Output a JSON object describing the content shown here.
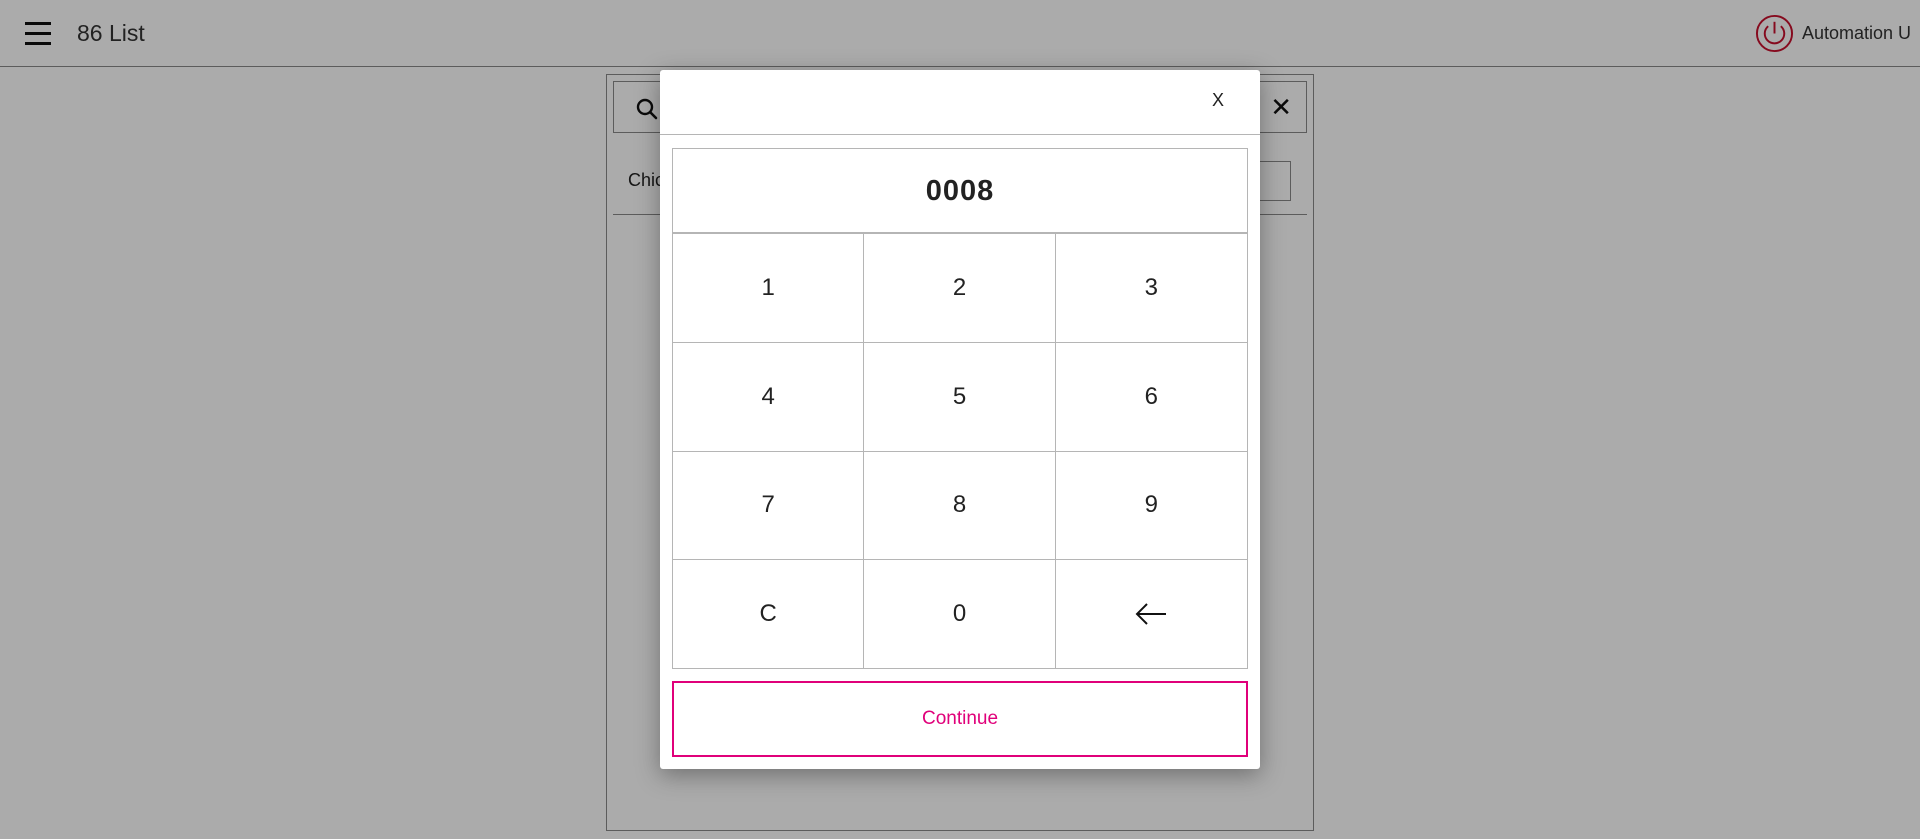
{
  "header": {
    "title": "86 List",
    "user_name": "Automation U",
    "power_icon": "power-icon"
  },
  "list": {
    "search_icon": "search-icon",
    "clear_icon": "close-icon",
    "rows": [
      {
        "label": "Chic"
      }
    ]
  },
  "modal": {
    "close_label": "X",
    "pin_value": "0008",
    "keys": [
      "1",
      "2",
      "3",
      "4",
      "5",
      "6",
      "7",
      "8",
      "9",
      "C",
      "0",
      "backspace-arrow"
    ],
    "continue_label": "Continue"
  },
  "colors": {
    "accent": "#e0007a",
    "power": "#c8102e",
    "overlay": "rgba(0,0,0,0.33)"
  }
}
